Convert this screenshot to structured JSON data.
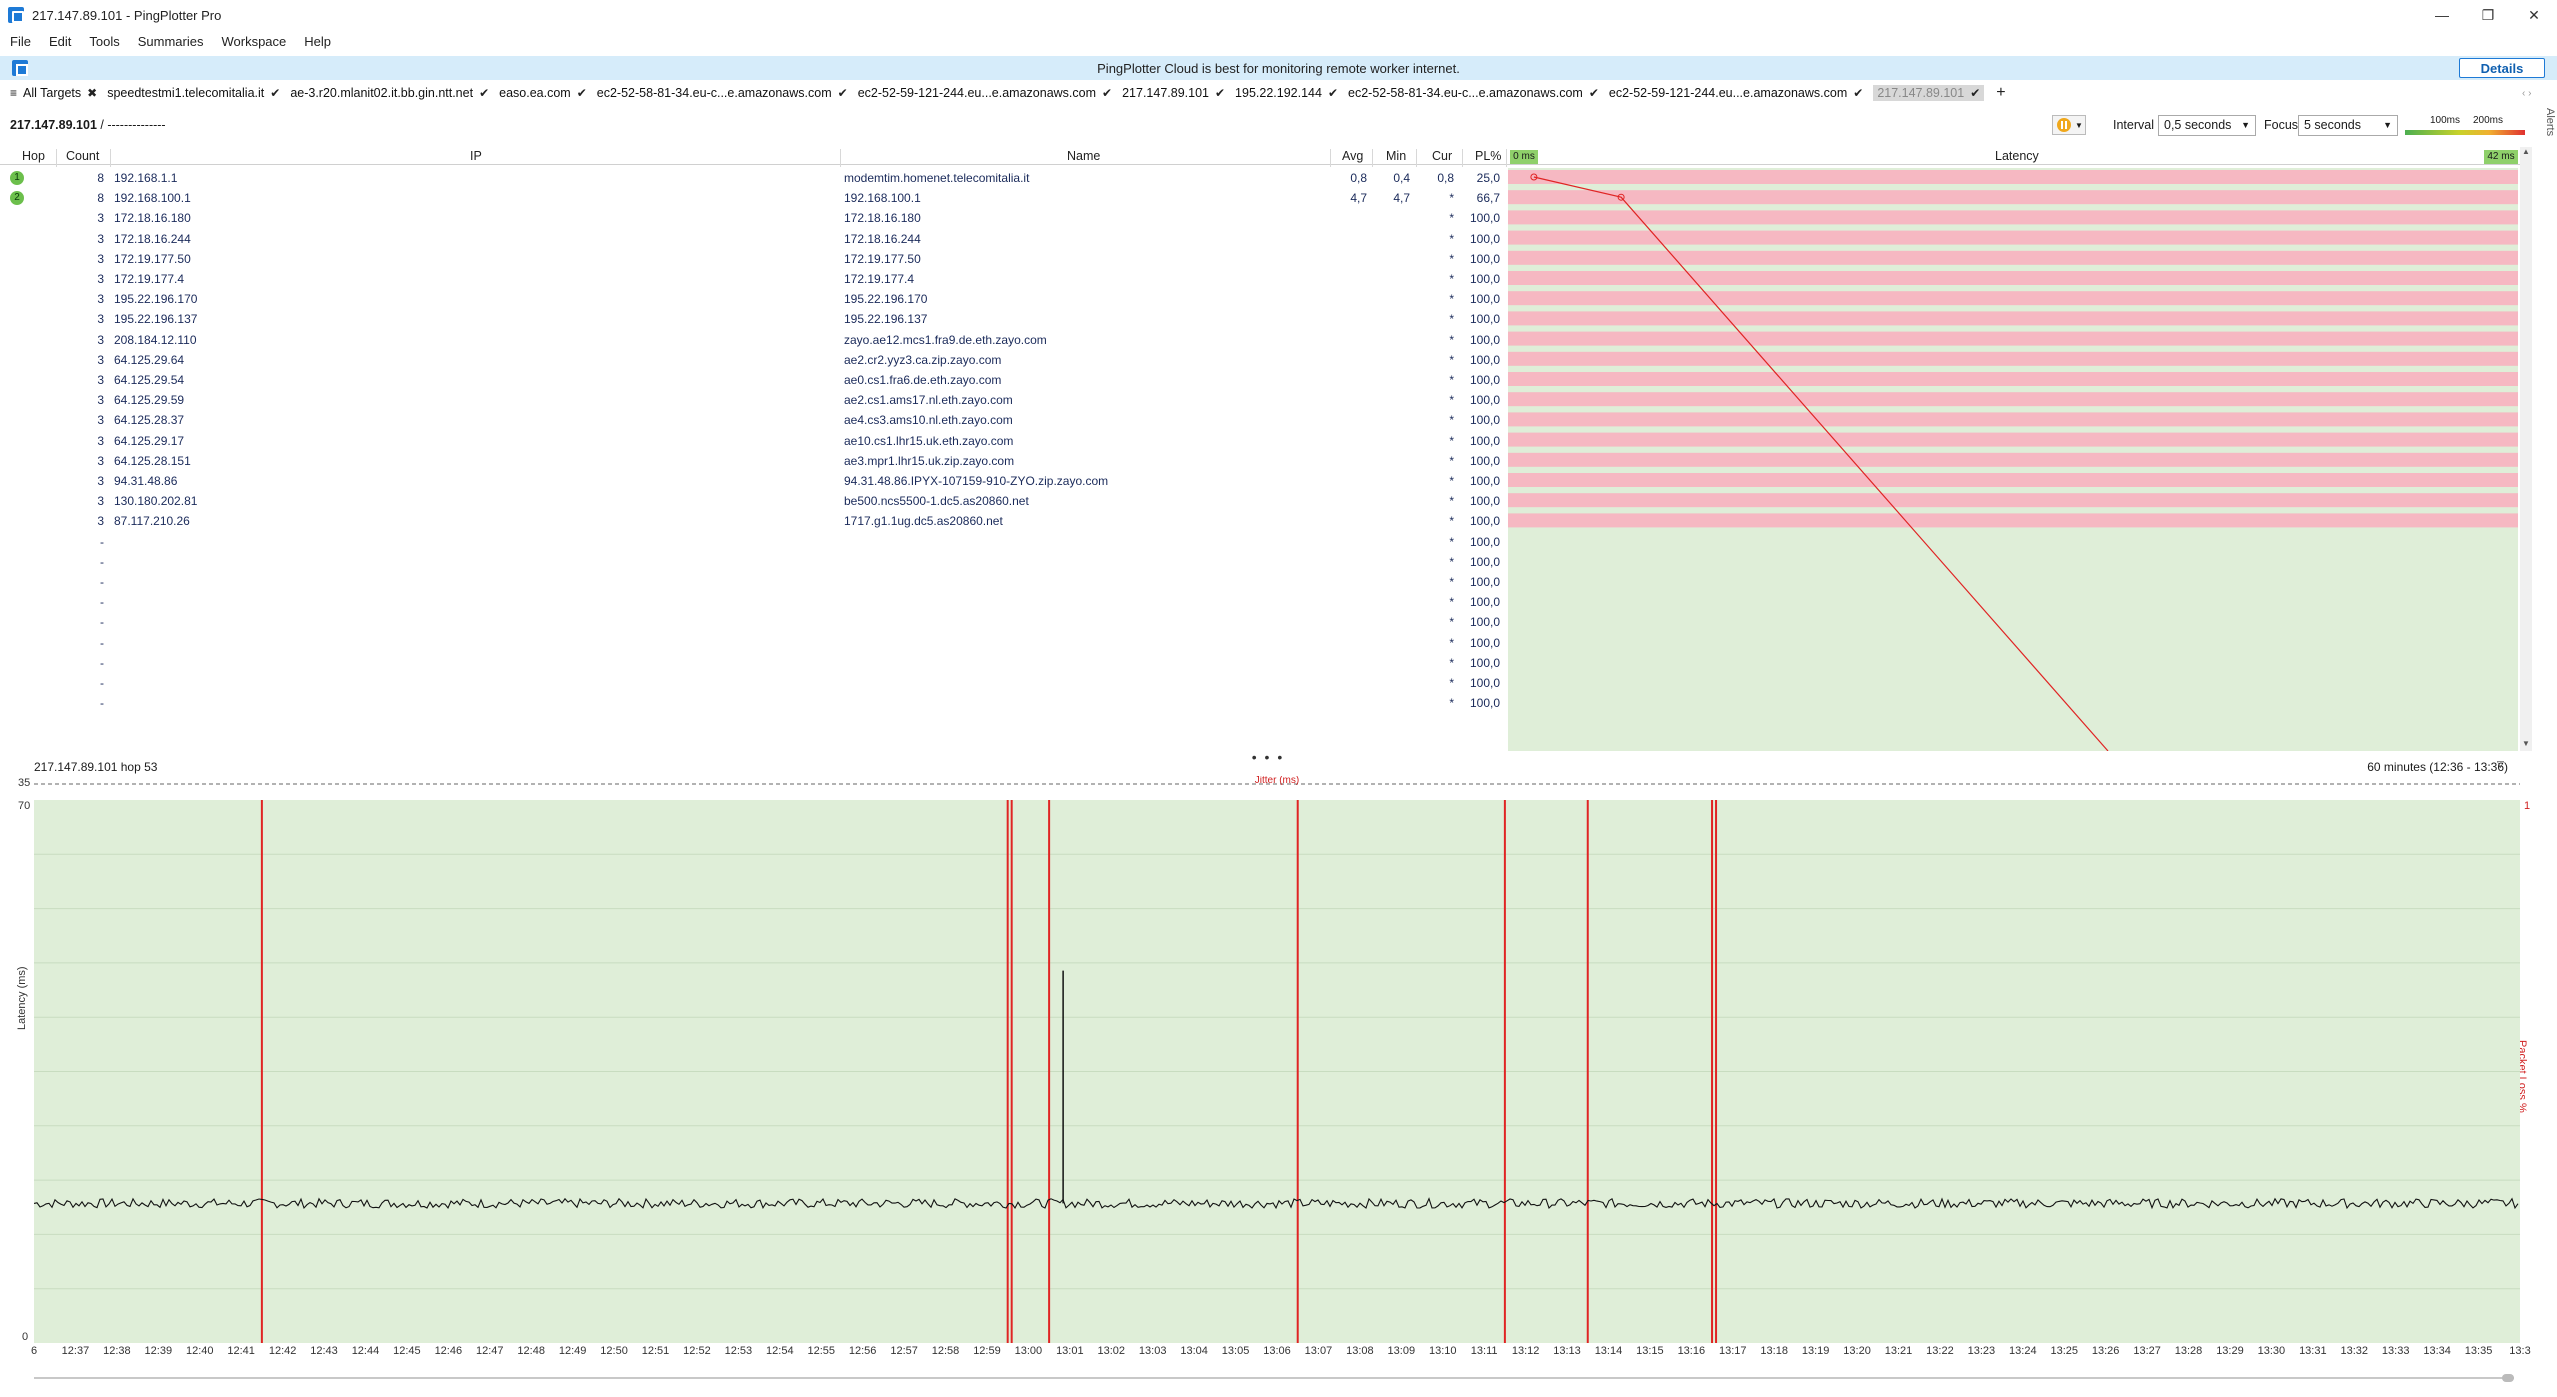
{
  "window": {
    "title": "217.147.89.101 - PingPlotter Pro",
    "minimize": "—",
    "restore": "❐",
    "close": "✕"
  },
  "menu": [
    "File",
    "Edit",
    "Tools",
    "Summaries",
    "Workspace",
    "Help"
  ],
  "banner": {
    "message": "PingPlotter Cloud is best for monitoring remote worker internet.",
    "button": "Details"
  },
  "tabs": [
    {
      "label": "All Targets",
      "mark": "✖"
    },
    {
      "label": "speedtestmi1.telecomitalia.it",
      "mark": "✔"
    },
    {
      "label": "ae-3.r20.mlanit02.it.bb.gin.ntt.net",
      "mark": "✔"
    },
    {
      "label": "easo.ea.com",
      "mark": "✔"
    },
    {
      "label": "ec2-52-58-81-34.eu-c...e.amazonaws.com",
      "mark": "✔"
    },
    {
      "label": "ec2-52-59-121-244.eu...e.amazonaws.com",
      "mark": "✔"
    },
    {
      "label": "217.147.89.101",
      "mark": "✔"
    },
    {
      "label": "195.22.192.144",
      "mark": "✔"
    },
    {
      "label": "ec2-52-58-81-34.eu-c...e.amazonaws.com",
      "mark": "✔"
    },
    {
      "label": "ec2-52-59-121-244.eu...e.amazonaws.com",
      "mark": "✔"
    },
    {
      "label": "217.147.89.101",
      "mark": "✔",
      "active": true
    }
  ],
  "add_tab": "+",
  "subheader": {
    "target": "217.147.89.101",
    "separator": " / ",
    "trail": "--------------",
    "interval_label": "Interval",
    "interval_value": "0,5 seconds",
    "focus_label": "Focus",
    "focus_value": "5 seconds",
    "scale_low": "100ms",
    "scale_high": "200ms",
    "alerts_label": "Alerts"
  },
  "table": {
    "headers": {
      "hop": "Hop",
      "count": "Count",
      "ip": "IP",
      "name": "Name",
      "avg": "Avg",
      "min": "Min",
      "cur": "Cur",
      "pl": "PL%",
      "latency": "Latency",
      "lat_min": "0 ms",
      "lat_max": "42 ms"
    },
    "rows": [
      {
        "hop": "1",
        "count": "8",
        "ip": "192.168.1.1",
        "name": "modemtim.homenet.telecomitalia.it",
        "avg": "0,8",
        "min": "0,4",
        "cur": "0,8",
        "pl": "25,0"
      },
      {
        "hop": "2",
        "count": "8",
        "ip": "192.168.100.1",
        "name": "192.168.100.1",
        "avg": "4,7",
        "min": "4,7",
        "cur": "*",
        "pl": "66,7"
      },
      {
        "hop": "",
        "count": "3",
        "ip": "172.18.16.180",
        "name": "172.18.16.180",
        "avg": "",
        "min": "",
        "cur": "*",
        "pl": "100,0"
      },
      {
        "hop": "",
        "count": "3",
        "ip": "172.18.16.244",
        "name": "172.18.16.244",
        "avg": "",
        "min": "",
        "cur": "*",
        "pl": "100,0"
      },
      {
        "hop": "",
        "count": "3",
        "ip": "172.19.177.50",
        "name": "172.19.177.50",
        "avg": "",
        "min": "",
        "cur": "*",
        "pl": "100,0"
      },
      {
        "hop": "",
        "count": "3",
        "ip": "172.19.177.4",
        "name": "172.19.177.4",
        "avg": "",
        "min": "",
        "cur": "*",
        "pl": "100,0"
      },
      {
        "hop": "",
        "count": "3",
        "ip": "195.22.196.170",
        "name": "195.22.196.170",
        "avg": "",
        "min": "",
        "cur": "*",
        "pl": "100,0"
      },
      {
        "hop": "",
        "count": "3",
        "ip": "195.22.196.137",
        "name": "195.22.196.137",
        "avg": "",
        "min": "",
        "cur": "*",
        "pl": "100,0"
      },
      {
        "hop": "",
        "count": "3",
        "ip": "208.184.12.110",
        "name": "zayo.ae12.mcs1.fra9.de.eth.zayo.com",
        "avg": "",
        "min": "",
        "cur": "*",
        "pl": "100,0"
      },
      {
        "hop": "",
        "count": "3",
        "ip": "64.125.29.64",
        "name": "ae2.cr2.yyz3.ca.zip.zayo.com",
        "avg": "",
        "min": "",
        "cur": "*",
        "pl": "100,0"
      },
      {
        "hop": "",
        "count": "3",
        "ip": "64.125.29.54",
        "name": "ae0.cs1.fra6.de.eth.zayo.com",
        "avg": "",
        "min": "",
        "cur": "*",
        "pl": "100,0"
      },
      {
        "hop": "",
        "count": "3",
        "ip": "64.125.29.59",
        "name": "ae2.cs1.ams17.nl.eth.zayo.com",
        "avg": "",
        "min": "",
        "cur": "*",
        "pl": "100,0"
      },
      {
        "hop": "",
        "count": "3",
        "ip": "64.125.28.37",
        "name": "ae4.cs3.ams10.nl.eth.zayo.com",
        "avg": "",
        "min": "",
        "cur": "*",
        "pl": "100,0"
      },
      {
        "hop": "",
        "count": "3",
        "ip": "64.125.29.17",
        "name": "ae10.cs1.lhr15.uk.eth.zayo.com",
        "avg": "",
        "min": "",
        "cur": "*",
        "pl": "100,0"
      },
      {
        "hop": "",
        "count": "3",
        "ip": "64.125.28.151",
        "name": "ae3.mpr1.lhr15.uk.zip.zayo.com",
        "avg": "",
        "min": "",
        "cur": "*",
        "pl": "100,0"
      },
      {
        "hop": "",
        "count": "3",
        "ip": "94.31.48.86",
        "name": "94.31.48.86.IPYX-107159-910-ZYO.zip.zayo.com",
        "avg": "",
        "min": "",
        "cur": "*",
        "pl": "100,0"
      },
      {
        "hop": "",
        "count": "3",
        "ip": "130.180.202.81",
        "name": "be500.ncs5500-1.dc5.as20860.net",
        "avg": "",
        "min": "",
        "cur": "*",
        "pl": "100,0"
      },
      {
        "hop": "",
        "count": "3",
        "ip": "87.117.210.26",
        "name": "1717.g1.1ug.dc5.as20860.net",
        "avg": "",
        "min": "",
        "cur": "*",
        "pl": "100,0"
      },
      {
        "hop": "",
        "count": "-",
        "ip": "",
        "name": "",
        "avg": "",
        "min": "",
        "cur": "*",
        "pl": "100,0"
      },
      {
        "hop": "",
        "count": "-",
        "ip": "",
        "name": "",
        "avg": "",
        "min": "",
        "cur": "*",
        "pl": "100,0"
      },
      {
        "hop": "",
        "count": "-",
        "ip": "",
        "name": "",
        "avg": "",
        "min": "",
        "cur": "*",
        "pl": "100,0"
      },
      {
        "hop": "",
        "count": "-",
        "ip": "",
        "name": "",
        "avg": "",
        "min": "",
        "cur": "*",
        "pl": "100,0"
      },
      {
        "hop": "",
        "count": "-",
        "ip": "",
        "name": "",
        "avg": "",
        "min": "",
        "cur": "*",
        "pl": "100,0"
      },
      {
        "hop": "",
        "count": "-",
        "ip": "",
        "name": "",
        "avg": "",
        "min": "",
        "cur": "*",
        "pl": "100,0"
      },
      {
        "hop": "",
        "count": "-",
        "ip": "",
        "name": "",
        "avg": "",
        "min": "",
        "cur": "*",
        "pl": "100,0"
      },
      {
        "hop": "",
        "count": "-",
        "ip": "",
        "name": "",
        "avg": "",
        "min": "",
        "cur": "*",
        "pl": "100,0"
      },
      {
        "hop": "",
        "count": "-",
        "ip": "",
        "name": "",
        "avg": "",
        "min": "",
        "cur": "*",
        "pl": "100,0"
      }
    ]
  },
  "latency_trace": {
    "points_ms": [
      0.8,
      4.7
    ],
    "loss_rows": 18,
    "color": "#e02424"
  },
  "splitter": "• • •",
  "graph": {
    "header_left": "217.147.89.101 hop 53",
    "header_right": "60 minutes (12:36 - 13:36)",
    "jitter_label": "Jitter (ms)",
    "jitter_max": "35",
    "y_max": "70",
    "y_min": "0",
    "pl_max": "1",
    "ylabel": "Latency (ms)",
    "pl_label": "Packet Loss %",
    "baseline_ms": 18,
    "spike_ms": 48,
    "spike_time": "13:00",
    "loss_times": [
      "12:41",
      "12:59",
      "12:59",
      "13:00",
      "13:06",
      "13:11",
      "13:13",
      "13:16",
      "13:16"
    ],
    "time_labels": [
      "6",
      "12:37",
      "12:38",
      "12:39",
      "12:40",
      "12:41",
      "12:42",
      "12:43",
      "12:44",
      "12:45",
      "12:46",
      "12:47",
      "12:48",
      "12:49",
      "12:50",
      "12:51",
      "12:52",
      "12:53",
      "12:54",
      "12:55",
      "12:56",
      "12:57",
      "12:58",
      "12:59",
      "13:00",
      "13:01",
      "13:02",
      "13:03",
      "13:04",
      "13:05",
      "13:06",
      "13:07",
      "13:08",
      "13:09",
      "13:10",
      "13:11",
      "13:12",
      "13:13",
      "13:14",
      "13:15",
      "13:16",
      "13:17",
      "13:18",
      "13:19",
      "13:20",
      "13:21",
      "13:22",
      "13:23",
      "13:24",
      "13:25",
      "13:26",
      "13:27",
      "13:28",
      "13:29",
      "13:30",
      "13:31",
      "13:32",
      "13:33",
      "13:34",
      "13:35",
      "13:3"
    ]
  },
  "colors": {
    "loss_red": "#e02424",
    "ok_green": "#dfeed8",
    "loss_pink": "#f6b8c2",
    "link_blue": "#1a2a5a"
  }
}
